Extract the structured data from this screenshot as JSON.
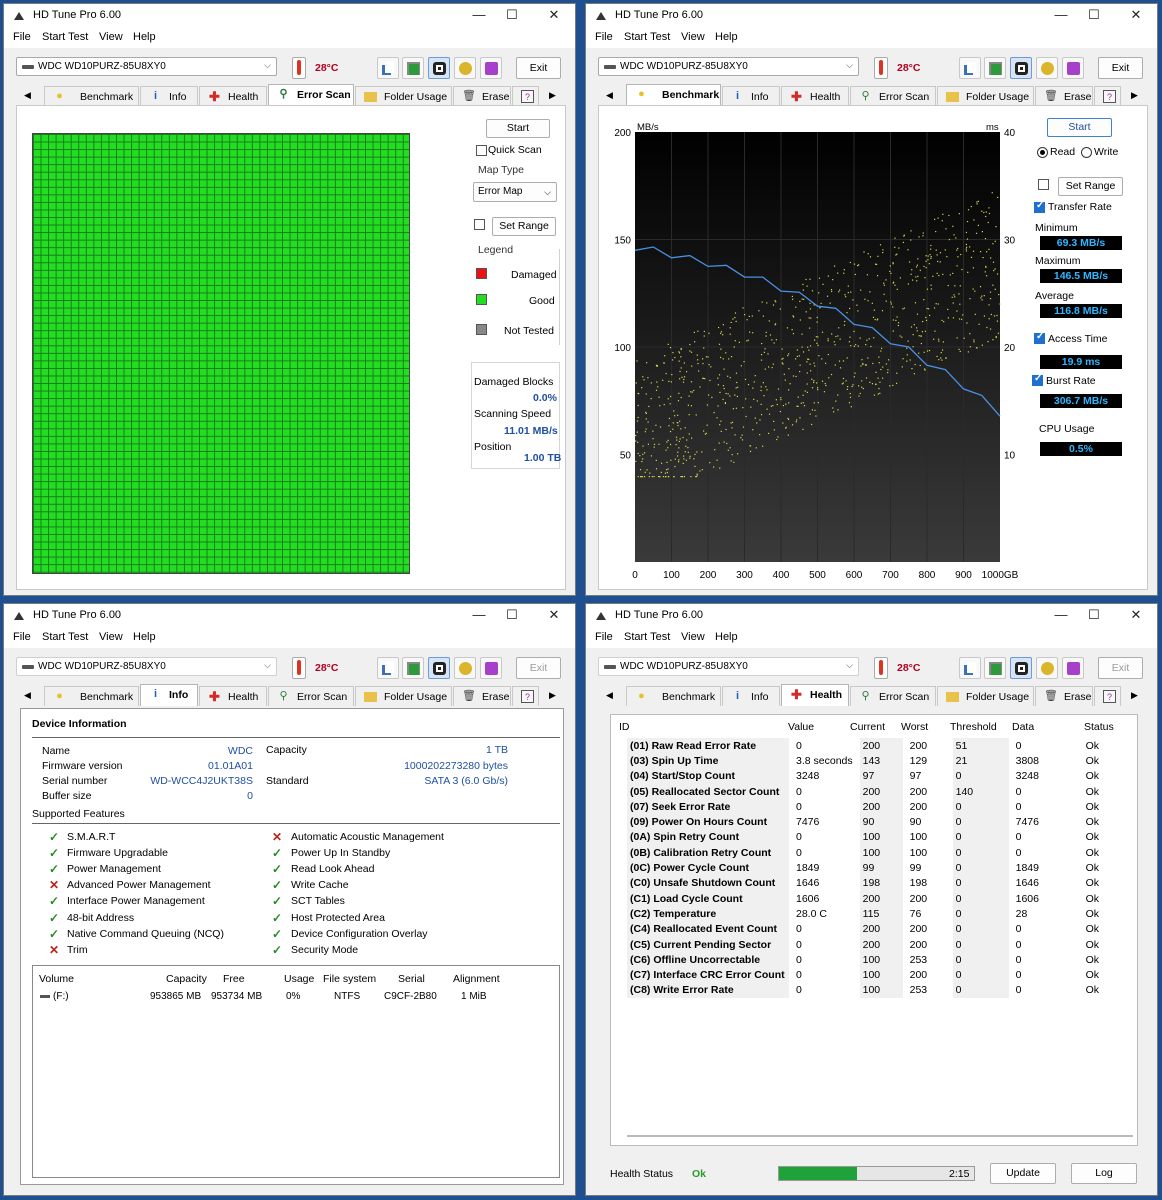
{
  "app_title": "HD Tune Pro 6.00",
  "menu": [
    "File",
    "Start Test",
    "View",
    "Help"
  ],
  "drive": "WDC WD10PURZ-85U8XY0",
  "temperature": "28°C",
  "exit_label": "Exit",
  "tabs": [
    "Benchmark",
    "Info",
    "Health",
    "Error Scan",
    "Folder Usage",
    "Erase"
  ],
  "window_buttons": {
    "minimize": "—",
    "maximize": "☐",
    "close": "✕"
  },
  "error_scan": {
    "start": "Start",
    "quick_scan": "Quick Scan",
    "map_type_label": "Map Type",
    "map_type_value": "Error Map",
    "set_range": "Set Range",
    "legend_title": "Legend",
    "legend_damaged": "Damaged",
    "legend_good": "Good",
    "legend_not_tested": "Not Tested",
    "damaged_blocks_label": "Damaged Blocks",
    "damaged_blocks_value": "0.0%",
    "scanning_speed_label": "Scanning Speed",
    "scanning_speed_value": "11.01 MB/s",
    "position_label": "Position",
    "position_value": "1.00 TB",
    "colors": {
      "good": "#22dd22",
      "grid": "#1a7a1a"
    }
  },
  "benchmark": {
    "start": "Start",
    "read": "Read",
    "write": "Write",
    "set_range": "Set Range",
    "transfer_rate": "Transfer Rate",
    "minimum_label": "Minimum",
    "minimum_value": "69.3 MB/s",
    "maximum_label": "Maximum",
    "maximum_value": "146.5 MB/s",
    "average_label": "Average",
    "average_value": "116.8 MB/s",
    "access_time": "Access Time",
    "access_time_value": "19.9 ms",
    "burst_rate": "Burst Rate",
    "burst_rate_value": "306.7 MB/s",
    "cpu_usage_label": "CPU Usage",
    "cpu_usage_value": "0.5%"
  },
  "chart_data": {
    "type": "line",
    "xlabel": "GB",
    "ylabel": "MB/s",
    "y2label": "ms",
    "xlim": [
      0,
      1000
    ],
    "ylim": [
      0,
      200
    ],
    "y2lim": [
      0,
      40
    ],
    "x_ticks": [
      "0",
      "100",
      "200",
      "300",
      "400",
      "500",
      "600",
      "700",
      "800",
      "900",
      "1000GB"
    ],
    "y_ticks": [
      "50",
      "100",
      "150",
      "200"
    ],
    "y2_ticks": [
      "10",
      "20",
      "30",
      "40"
    ],
    "series": [
      {
        "color": "#4a90e2",
        "x": [
          0,
          50,
          100,
          150,
          200,
          250,
          300,
          350,
          400,
          450,
          500,
          550,
          600,
          650,
          700,
          750,
          800,
          850,
          900,
          950,
          1000
        ],
        "values": [
          146.5,
          145,
          143,
          141,
          139,
          136.5,
          134,
          131,
          127.5,
          124,
          120.5,
          116.5,
          112,
          107.5,
          103,
          98.5,
          93,
          88,
          82,
          76,
          69.3
        ]
      }
    ],
    "colors": {
      "background": "#000000",
      "gridline": "#2a2a2a",
      "access_dots": "#d7d74a"
    }
  },
  "info": {
    "device_info_title": "Device Information",
    "left": [
      {
        "k": "Name",
        "v": "WDC"
      },
      {
        "k": "Firmware version",
        "v": "01.01A01"
      },
      {
        "k": "Serial number",
        "v": "WD-WCC4J2UKT38S"
      },
      {
        "k": "Buffer size",
        "v": "0"
      }
    ],
    "capacity_label": "Capacity",
    "capacity_value": "1 TB",
    "capacity_bytes": "1000202273280 bytes",
    "standard_label": "Standard",
    "standard_value": "SATA 3 (6.0 Gb/s)",
    "supported_features_title": "Supported Features",
    "features_left": [
      {
        "name": "S.M.A.R.T",
        "ok": true
      },
      {
        "name": "Firmware Upgradable",
        "ok": true
      },
      {
        "name": "Power Management",
        "ok": true
      },
      {
        "name": "Advanced Power Management",
        "ok": false
      },
      {
        "name": "Interface Power Management",
        "ok": true
      },
      {
        "name": "48-bit Address",
        "ok": true
      },
      {
        "name": "Native Command Queuing (NCQ)",
        "ok": true
      },
      {
        "name": "Trim",
        "ok": false
      }
    ],
    "features_right": [
      {
        "name": "Automatic Acoustic Management",
        "ok": false
      },
      {
        "name": "Power Up In Standby",
        "ok": true
      },
      {
        "name": "Read Look Ahead",
        "ok": true
      },
      {
        "name": "Write Cache",
        "ok": true
      },
      {
        "name": "SCT Tables",
        "ok": true
      },
      {
        "name": "Host Protected Area",
        "ok": true
      },
      {
        "name": "Device Configuration Overlay",
        "ok": true
      },
      {
        "name": "Security Mode",
        "ok": true
      }
    ],
    "volume_headers": [
      "Volume",
      "Capacity",
      "Free",
      "Usage",
      "File system",
      "Serial",
      "Alignment"
    ],
    "volumes": [
      [
        "(F:)",
        "953865 MB",
        "953734 MB",
        "0%",
        "NTFS",
        "C9CF-2B80",
        "1 MiB"
      ]
    ]
  },
  "health": {
    "headers": [
      "ID",
      "Value",
      "Current",
      "Worst",
      "Threshold",
      "Data",
      "Status"
    ],
    "rows": [
      [
        "(01) Raw Read Error Rate",
        "0",
        "200",
        "200",
        "51",
        "0",
        "Ok"
      ],
      [
        "(03) Spin Up Time",
        "3.8 seconds",
        "143",
        "129",
        "21",
        "3808",
        "Ok"
      ],
      [
        "(04) Start/Stop Count",
        "3248",
        "97",
        "97",
        "0",
        "3248",
        "Ok"
      ],
      [
        "(05) Reallocated Sector Count",
        "0",
        "200",
        "200",
        "140",
        "0",
        "Ok"
      ],
      [
        "(07) Seek Error Rate",
        "0",
        "200",
        "200",
        "0",
        "0",
        "Ok"
      ],
      [
        "(09) Power On Hours Count",
        "7476",
        "90",
        "90",
        "0",
        "7476",
        "Ok"
      ],
      [
        "(0A) Spin Retry Count",
        "0",
        "100",
        "100",
        "0",
        "0",
        "Ok"
      ],
      [
        "(0B) Calibration Retry Count",
        "0",
        "100",
        "100",
        "0",
        "0",
        "Ok"
      ],
      [
        "(0C) Power Cycle Count",
        "1849",
        "99",
        "99",
        "0",
        "1849",
        "Ok"
      ],
      [
        "(C0) Unsafe Shutdown Count",
        "1646",
        "198",
        "198",
        "0",
        "1646",
        "Ok"
      ],
      [
        "(C1) Load Cycle Count",
        "1606",
        "200",
        "200",
        "0",
        "1606",
        "Ok"
      ],
      [
        "(C2) Temperature",
        "28.0 C",
        "115",
        "76",
        "0",
        "28",
        "Ok"
      ],
      [
        "(C4) Reallocated Event Count",
        "0",
        "200",
        "200",
        "0",
        "0",
        "Ok"
      ],
      [
        "(C5) Current Pending Sector",
        "0",
        "200",
        "200",
        "0",
        "0",
        "Ok"
      ],
      [
        "(C6) Offline Uncorrectable",
        "0",
        "100",
        "253",
        "0",
        "0",
        "Ok"
      ],
      [
        "(C7) Interface CRC Error Count",
        "0",
        "100",
        "200",
        "0",
        "0",
        "Ok"
      ],
      [
        "(C8) Write Error Rate",
        "0",
        "100",
        "253",
        "0",
        "0",
        "Ok"
      ]
    ],
    "health_status_label": "Health Status",
    "health_status_value": "Ok",
    "progress_fraction": 0.4,
    "timer": "2:15",
    "update": "Update",
    "log": "Log"
  }
}
